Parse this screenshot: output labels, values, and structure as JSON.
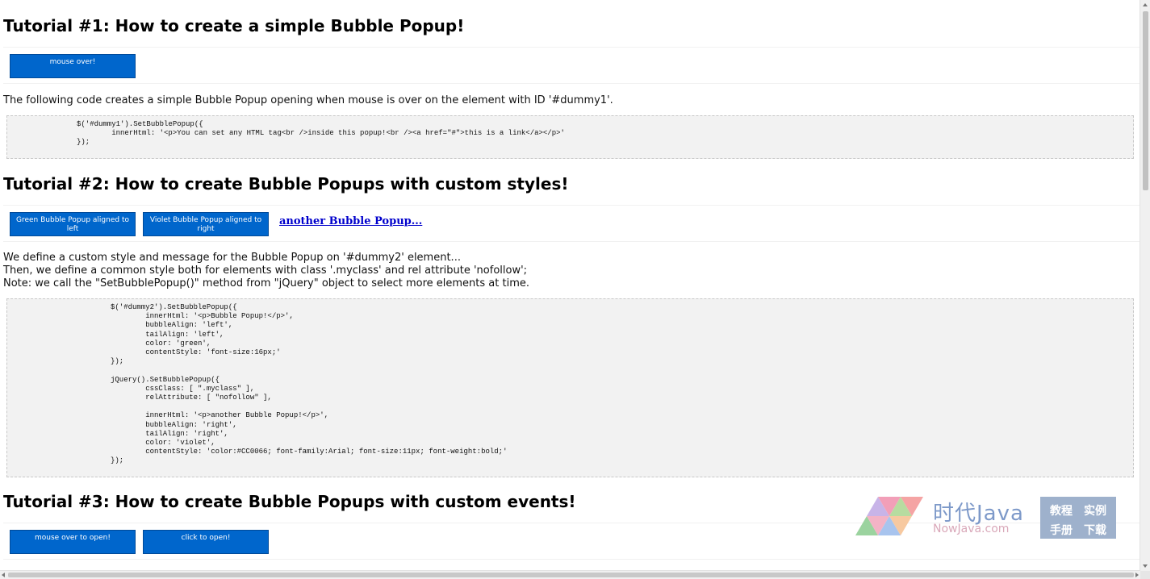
{
  "tutorial1": {
    "title": "Tutorial #1: How to create a simple Bubble Popup!",
    "button": "mouse over!",
    "description": "The following code creates a simple Bubble Popup opening when mouse is over on the element with ID '#dummy1'.",
    "code": "$('#dummy1').SetBubblePopup({\n        innerHtml: '<p>You can set any HTML tag<br />inside this popup!<br /><a href=\"#\">this is a link</a></p>'\n});"
  },
  "tutorial2": {
    "title": "Tutorial #2: How to create Bubble Popups with custom styles!",
    "button_green": "Green Bubble Popup aligned to left",
    "button_violet": "Violet Bubble Popup aligned to right",
    "link": "another Bubble Popup...",
    "description_lines": [
      "We define a custom style and message for the Bubble Popup on '#dummy2' element...",
      "Then, we define a common style both for elements with class '.myclass' and rel attribute 'nofollow';",
      "Note: we call the \"SetBubblePopup()\" method from \"jQuery\" object to select more elements at time."
    ],
    "code": "$('#dummy2').SetBubblePopup({\n        innerHtml: '<p>Bubble Popup!</p>',\n        bubbleAlign: 'left',\n        tailAlign: 'left',\n        color: 'green',\n        contentStyle: 'font-size:16px;'\n});\n\njQuery().SetBubblePopup({\n        cssClass: [ \".myclass\" ],\n        relAttribute: [ \"nofollow\" ],\n\n        innerHtml: '<p>another Bubble Popup!</p>',\n        bubbleAlign: 'right',\n        tailAlign: 'right',\n        color: 'violet',\n        contentStyle: 'color:#CC0066; font-family:Arial; font-size:11px; font-weight:bold;'\n});"
  },
  "tutorial3": {
    "title": "Tutorial #3: How to create Bubble Popups with custom events!",
    "button_mouseover": "mouse over to open!",
    "button_click": "click to open!"
  },
  "watermark": {
    "cn": "时代Java",
    "en": "NowJava.com",
    "box": [
      "教程",
      "实例",
      "手册",
      "下载"
    ]
  },
  "colors": {
    "button_bg": "#0066cc",
    "link": "#0000cc",
    "code_bg": "#f2f2f2"
  }
}
